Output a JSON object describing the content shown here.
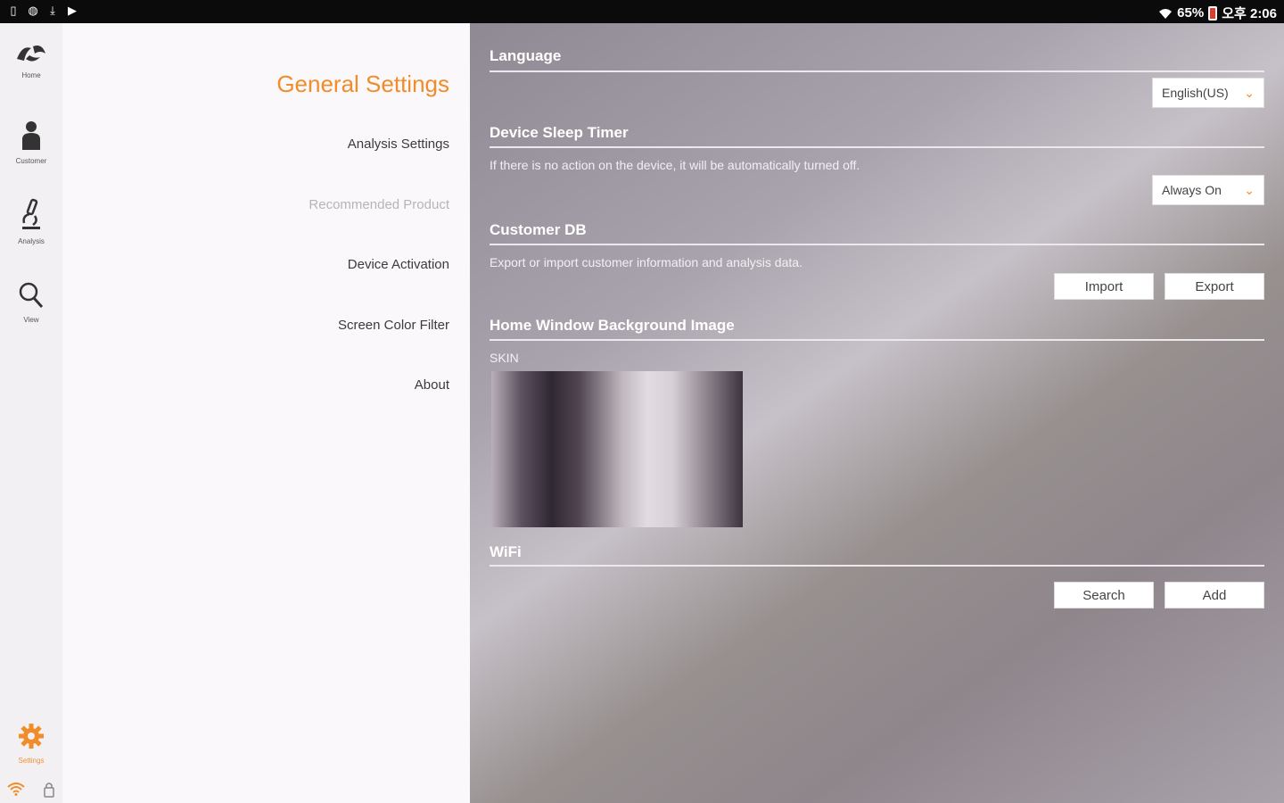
{
  "status_bar": {
    "battery": "65%",
    "time": "오후 2:06"
  },
  "rail": {
    "items": [
      {
        "label": "Home"
      },
      {
        "label": "Customer"
      },
      {
        "label": "Analysis"
      },
      {
        "label": "View"
      }
    ],
    "settings_label": "Settings"
  },
  "menu": {
    "title": "General Settings",
    "items": [
      {
        "label": "Analysis Settings"
      },
      {
        "label": "Recommended Product"
      },
      {
        "label": "Device Activation"
      },
      {
        "label": "Screen Color Filter"
      },
      {
        "label": "About"
      }
    ]
  },
  "content": {
    "language": {
      "title": "Language",
      "value": "English(US)"
    },
    "sleep_timer": {
      "title": "Device Sleep Timer",
      "description": "If there is no action on the device, it will be automatically turned off.",
      "value": "Always On"
    },
    "customer_db": {
      "title": "Customer DB",
      "description": "Export or import customer information and analysis data.",
      "import_label": "Import",
      "export_label": "Export"
    },
    "background": {
      "title": "Home Window Background Image",
      "skin_label": "SKIN"
    },
    "wifi": {
      "title": "WiFi",
      "search_label": "Search",
      "add_label": "Add"
    }
  },
  "colors": {
    "accent": "#f28c28",
    "rail_bg": "#f3f0f4",
    "menu_bg": "#faf8fb"
  }
}
